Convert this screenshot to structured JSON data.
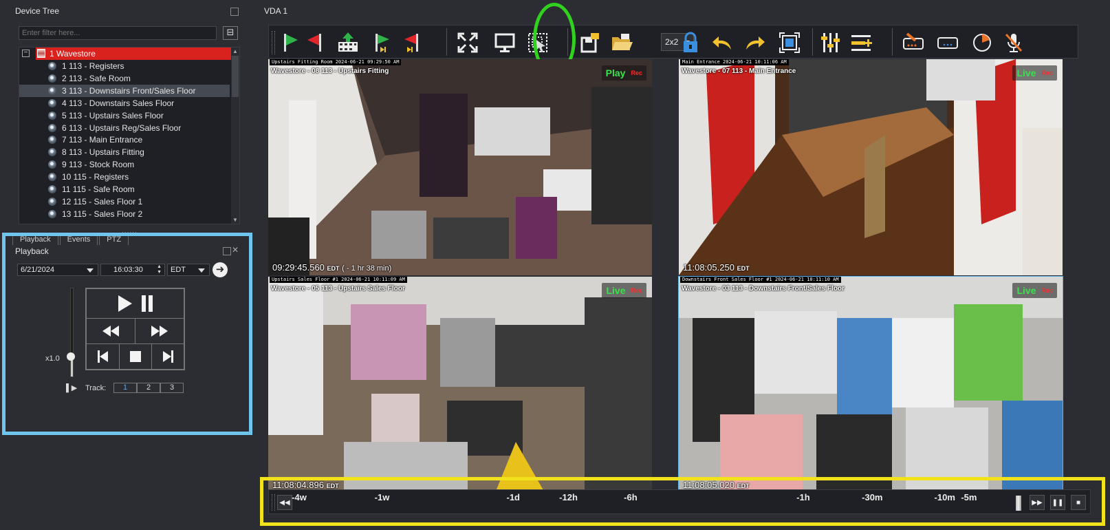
{
  "device_tree": {
    "title": "Device Tree",
    "filter_placeholder": "Enter filter here...",
    "root": {
      "label": "1 Wavestore"
    },
    "items": [
      {
        "label": "1 113 - Registers"
      },
      {
        "label": "2 113 - Safe Room"
      },
      {
        "label": "3 113 -  Downstairs Front/Sales Floor",
        "selected": true
      },
      {
        "label": "4 113 -  Downstairs Sales Floor"
      },
      {
        "label": "5 113 -  Upstairs Sales Floor"
      },
      {
        "label": "6 113 - Upstairs Reg/Sales Floor"
      },
      {
        "label": "7 113 - Main Entrance"
      },
      {
        "label": "8 113 - Upstairs Fitting"
      },
      {
        "label": "9 113 - Stock Room"
      },
      {
        "label": "10 115 - Registers"
      },
      {
        "label": "11 115 - Safe Room"
      },
      {
        "label": "12 115 - Sales Floor 1"
      },
      {
        "label": "13 115 - Sales Floor 2"
      }
    ]
  },
  "tabs": [
    "Playback",
    "Events",
    "PTZ"
  ],
  "playback": {
    "title": "Playback",
    "date": "6/21/2024",
    "time": "16:03:30",
    "timezone": "EDT",
    "speed_label": "x1.0",
    "speed_level": 0.22,
    "track_label": "Track:",
    "tracks": [
      "1",
      "2",
      "3"
    ],
    "active_track": "1"
  },
  "vda": {
    "title": "VDA 1",
    "layout": "2x2"
  },
  "tiles": [
    {
      "osd_top": "Upstairs Fitting Room 2024-06-21 09:29:50 AM",
      "camera": "Wavestore - 08 113 - Upstairs Fitting",
      "status": "Play",
      "rec": "Rec",
      "time": "09:29:45.560",
      "tz": "EDT",
      "extra": "( - 1 hr 38 min)"
    },
    {
      "osd_top": "Main Entrance 2024-06-21 10:11:06 AM",
      "camera": "Wavestore - 07 113 - Main Entrance",
      "status": "Live",
      "rec": "Rec",
      "time": "11:08:05.250",
      "tz": "EDT",
      "extra": ""
    },
    {
      "osd_top": "Upstairs Sales Floor #1 2024-06-21 10:11:09 AM",
      "camera": "Wavestore - 05 113 - Upstairs Sales Floor",
      "status": "Live",
      "rec": "Rec",
      "time": "11:08:04.896",
      "tz": "EDT",
      "extra": ""
    },
    {
      "osd_top": "Downstairs Front Sales Floor #1 2024-06-21 10:11:10 AM",
      "camera": "Wavestore - 03 113 - Downstairs Front/Sales Floor",
      "status": "Live",
      "rec": "Rec",
      "time": "11:08:05.020",
      "tz": "EDT",
      "extra": ""
    }
  ],
  "timeline": {
    "ticks": [
      {
        "label": "-4w",
        "pos": 0.0
      },
      {
        "label": "-1w",
        "pos": 0.12
      },
      {
        "label": "-1d",
        "pos": 0.31
      },
      {
        "label": "-12h",
        "pos": 0.39
      },
      {
        "label": "-6h",
        "pos": 0.48
      },
      {
        "label": "-1h",
        "pos": 0.73
      },
      {
        "label": "-30m",
        "pos": 0.83
      },
      {
        "label": "-10m",
        "pos": 0.935
      },
      {
        "label": "-5m",
        "pos": 0.97
      }
    ]
  },
  "colors": {
    "root_highlight": "#d9221e",
    "playback_highlight": "#6ec5ee",
    "toolbar_circle": "#31d11f",
    "timeline_highlight": "#f2e21b",
    "live_text": "#39e34a",
    "rec_text": "#ff2a2a"
  }
}
